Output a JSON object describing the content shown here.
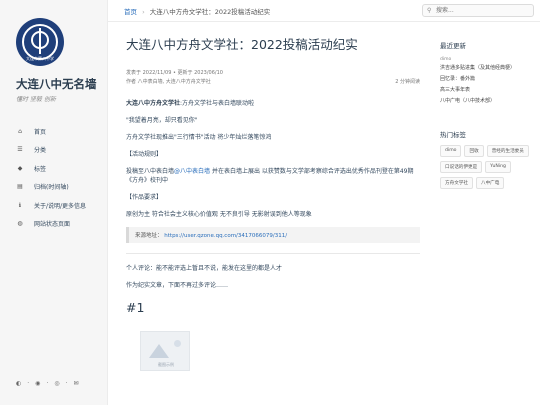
{
  "sidebar": {
    "logo_text": "大连市第八中学",
    "site_title": "大连八中无名墙",
    "subtitle": "懂时 坚毅 创新",
    "nav": [
      {
        "icon": "home-icon",
        "glyph": "⌂",
        "label": "首页"
      },
      {
        "icon": "category-icon",
        "glyph": "☰",
        "label": "分类"
      },
      {
        "icon": "tag-icon",
        "glyph": "◆",
        "label": "标签"
      },
      {
        "icon": "archive-icon",
        "glyph": "▤",
        "label": "归档(时间轴)"
      },
      {
        "icon": "info-icon",
        "glyph": "ℹ",
        "label": "关于/说明/更多信息"
      },
      {
        "icon": "globe-icon",
        "glyph": "◍",
        "label": "网站状态页面"
      }
    ],
    "bottom_icons": [
      "theme-toggle-icon",
      "github-icon",
      "rss-icon",
      "settings-icon"
    ]
  },
  "topbar": {
    "breadcrumb_home": "首页",
    "breadcrumb_current": "大连八中方舟文学社：2022投稿活动纪实",
    "search_placeholder": "搜索..."
  },
  "post": {
    "title": "大连八中方舟文学社：2022投稿活动纪实",
    "meta_dates": "发表于 2022/11/09 • 更新于 2023/06/10",
    "meta_authors": "作者 八中表白墙, 大连八中方舟文学社",
    "read_time": "2 分钟阅读",
    "p1_bold": "大连八中方舟文学社",
    "p1_rest": ":方舟文学社与表白墙联动啦",
    "p2": "\"我望着月亮，却只看见你\"",
    "p3": "方舟文学社现推出\"三行情书\"活动 将少年灿烂落笔惊鸿",
    "h_rules": "【活动规则】",
    "p4_a": "投稿至八中表白墙",
    "p4_link": "@八中表白墙",
    "p4_b": " 并在表白墙上展出 以获赞数与文学部考察综合评选出优秀作品刊登在第49期《方舟》校刊中",
    "h_requirements": "【作品要求】",
    "p5": "原创为主 符合社会主义核心价值观 无不良引导 无影射误到他人等现象",
    "source_label": "来源地址：",
    "source_url": "https://user.qzone.qq.com/3417066079/311/",
    "p6": "个人评论：能不能评选上暂且不说，能发在这里的都是人才",
    "p7": "作为纪实文章，下面不再过多评论……",
    "heading1": "#1",
    "thumb_caption": "截图示例"
  },
  "right": {
    "recent_title": "最近更新",
    "recent": [
      {
        "text": "dimo",
        "small": true
      },
      {
        "text": "洪吉通多贴进集（及其他经典梗）",
        "small": false
      },
      {
        "text": "回忆录：番外篇",
        "small": false
      },
      {
        "text": "高三大事年表",
        "small": false
      },
      {
        "text": "八中广电（八中技术部）",
        "small": false
      }
    ],
    "tags_title": "热门标签",
    "tags": [
      "dimo",
      "回收",
      "曾经的生活委员",
      "口说话的伊更是",
      "YuNing",
      "方舟文学社",
      "八中广电"
    ]
  }
}
